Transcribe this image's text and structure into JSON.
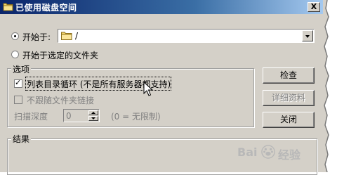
{
  "window": {
    "title": "已使用磁盘空间",
    "close_label": "X"
  },
  "start": {
    "radio_label": "开始于:",
    "path_value": "/",
    "selected_folder_label": "开始于选定的文件夹"
  },
  "options": {
    "title": "选项",
    "list_dir_loop_label": "列表目录循环 (不是所有服务器都支持)",
    "no_follow_links_label": "不跟随文件夹链接",
    "scan_depth_label": "扫描深度",
    "scan_depth_value": "0",
    "scan_depth_hint": "(0 = 无限制)"
  },
  "buttons": {
    "check": "检查",
    "details": "详细资料",
    "close": "关闭"
  },
  "results": {
    "title": "结果"
  },
  "watermark": {
    "brand": "Bai",
    "brand2": "经验"
  },
  "colors": {
    "titlebar_start": "#0a246a",
    "titlebar_end": "#a6caf0",
    "dialog_bg": "#d4d0c8"
  }
}
